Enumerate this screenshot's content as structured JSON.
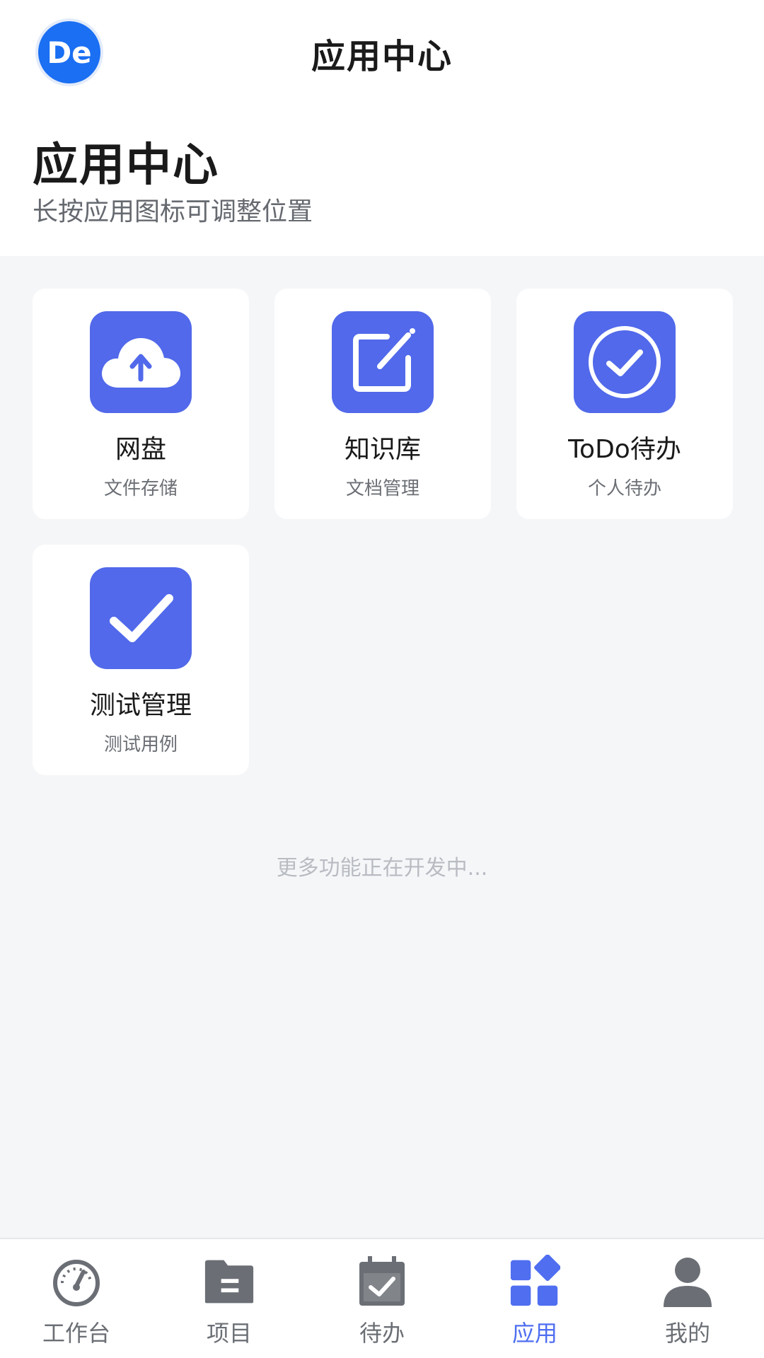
{
  "topbar": {
    "avatar_text": "De",
    "title": "应用中心"
  },
  "header": {
    "title": "应用中心",
    "subtitle": "长按应用图标可调整位置"
  },
  "apps": [
    {
      "title": "网盘",
      "subtitle": "文件存储",
      "icon": "cloud-upload-icon"
    },
    {
      "title": "知识库",
      "subtitle": "文档管理",
      "icon": "edit-note-icon"
    },
    {
      "title": "ToDo待办",
      "subtitle": "个人待办",
      "icon": "check-circle-icon"
    },
    {
      "title": "测试管理",
      "subtitle": "测试用例",
      "icon": "checkmark-icon"
    }
  ],
  "footer_hint": "更多功能正在开发中...",
  "bottom_nav": [
    {
      "label": "工作台",
      "icon": "dashboard-icon",
      "active": false
    },
    {
      "label": "项目",
      "icon": "folder-icon",
      "active": false
    },
    {
      "label": "待办",
      "icon": "calendar-check-icon",
      "active": false
    },
    {
      "label": "应用",
      "icon": "apps-grid-icon",
      "active": true
    },
    {
      "label": "我的",
      "icon": "user-icon",
      "active": false
    }
  ],
  "colors": {
    "accent": "#4f6ef0",
    "icon_bg": "#5169ea",
    "avatar_bg": "#1a6ff3",
    "page_bg": "#f5f6f8",
    "nav_inactive": "#6b6f75"
  }
}
